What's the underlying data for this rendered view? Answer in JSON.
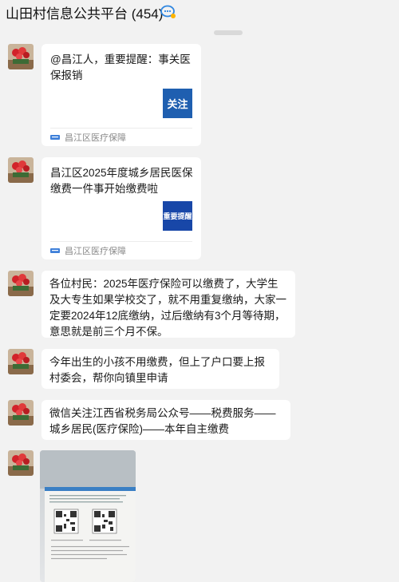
{
  "header": {
    "title": "山田村信息公共平台 (454)",
    "icon": "chat-bubble-icon"
  },
  "messages": [
    {
      "kind": "article",
      "text": "@昌江人，重要提醒：事关医保报销",
      "thumb": "关注",
      "thumb_color": "#1f5fb0",
      "source": "昌江区医疗保障"
    },
    {
      "kind": "article",
      "text": "昌江区2025年度城乡居民医保缴费一件事开始缴费啦",
      "thumb": "重要提醒",
      "thumb_color": "#1847a8",
      "source": "昌江区医疗保障"
    },
    {
      "kind": "text",
      "text": "各位村民：2025年医疗保险可以缴费了，大学生及大专生如果学校交了，就不用重复缴纳，大家一定要2024年12底缴纳，过后缴纳有3个月等待期，意思就是前三个月不保。"
    },
    {
      "kind": "text",
      "text": "今年出生的小孩不用缴费，但上了户口要上报村委会，帮你向镇里申请"
    },
    {
      "kind": "text",
      "text": "微信关注江西省税务局公众号——税费服务——城乡居民(医疗保险)——本年自主缴费"
    },
    {
      "kind": "image",
      "description": "photo-of-qr-code-flyer"
    }
  ],
  "colors": {
    "background": "#f2f2f2",
    "bubble": "#ffffff",
    "source_text": "#8a8a8a"
  }
}
